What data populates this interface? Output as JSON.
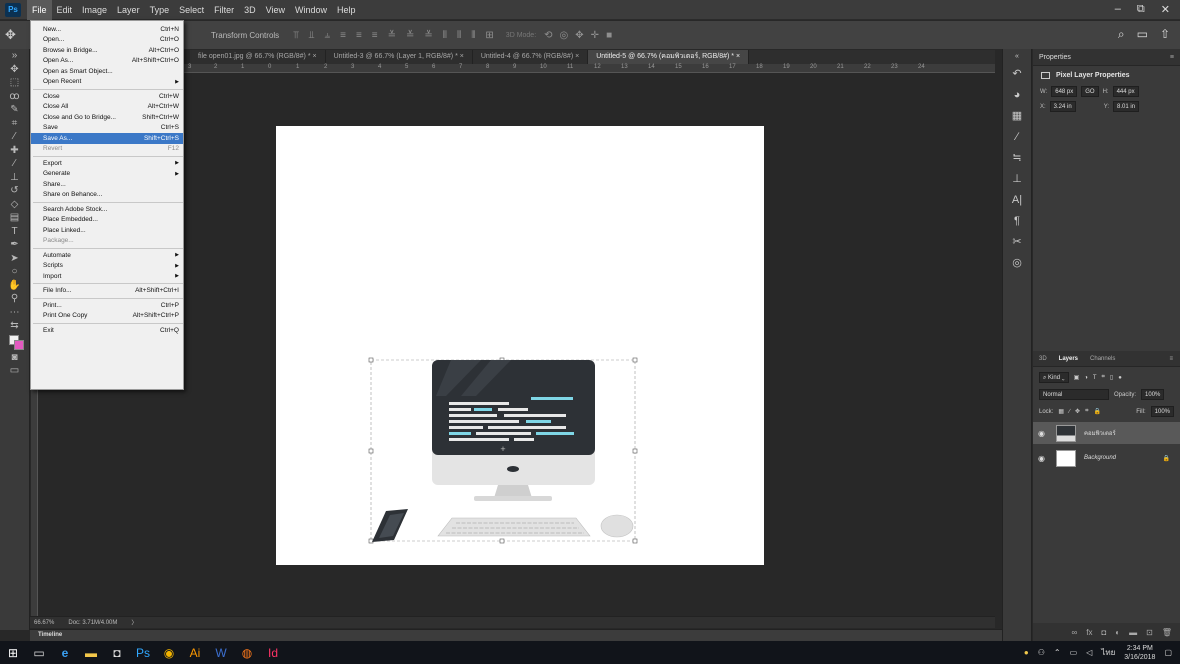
{
  "menubar": {
    "logo": "Ps",
    "items": [
      "File",
      "Edit",
      "Image",
      "Layer",
      "Type",
      "Select",
      "Filter",
      "3D",
      "View",
      "Window",
      "Help"
    ],
    "win_controls": [
      "–",
      "⧉",
      "✕"
    ]
  },
  "optionsbar": {
    "label": "Transform Controls",
    "mode_3d": "3D Mode:"
  },
  "tabs": [
    "file open01.jpg @ 66.7% (RGB/8#) * ×",
    "Untitled-3 @ 66.7% (Layer 1, RGB/8#) * ×",
    "Untitled-4 @ 66.7% (RGB/8#) ×",
    "Untitled-5 @ 66.7% (คอมพิวเตอร์, RGB/8#) * ×"
  ],
  "ruler": [
    "3",
    "2",
    "1",
    "0",
    "1",
    "2",
    "3",
    "4",
    "5",
    "6",
    "7",
    "8",
    "9",
    "10",
    "11",
    "12",
    "13",
    "14",
    "15",
    "16",
    "17",
    "18",
    "19",
    "20",
    "21",
    "22",
    "23",
    "24"
  ],
  "file_menu": [
    {
      "label": "New...",
      "shortcut": "Ctrl+N"
    },
    {
      "label": "Open...",
      "shortcut": "Ctrl+O"
    },
    {
      "label": "Browse in Bridge...",
      "shortcut": "Alt+Ctrl+O"
    },
    {
      "label": "Open As...",
      "shortcut": "Alt+Shift+Ctrl+O"
    },
    {
      "label": "Open as Smart Object...",
      "shortcut": ""
    },
    {
      "label": "Open Recent",
      "shortcut": "",
      "submenu": true
    },
    {
      "sep": true
    },
    {
      "label": "Close",
      "shortcut": "Ctrl+W"
    },
    {
      "label": "Close All",
      "shortcut": "Alt+Ctrl+W"
    },
    {
      "label": "Close and Go to Bridge...",
      "shortcut": "Shift+Ctrl+W"
    },
    {
      "label": "Save",
      "shortcut": "Ctrl+S"
    },
    {
      "label": "Save As...",
      "shortcut": "Shift+Ctrl+S",
      "highlighted": true
    },
    {
      "label": "Revert",
      "shortcut": "F12",
      "disabled": true
    },
    {
      "sep": true
    },
    {
      "label": "Export",
      "shortcut": "",
      "submenu": true
    },
    {
      "label": "Generate",
      "shortcut": "",
      "submenu": true
    },
    {
      "label": "Share...",
      "shortcut": ""
    },
    {
      "label": "Share on Behance...",
      "shortcut": ""
    },
    {
      "sep": true
    },
    {
      "label": "Search Adobe Stock...",
      "shortcut": ""
    },
    {
      "label": "Place Embedded...",
      "shortcut": ""
    },
    {
      "label": "Place Linked...",
      "shortcut": ""
    },
    {
      "label": "Package...",
      "shortcut": "",
      "disabled": true
    },
    {
      "sep": true
    },
    {
      "label": "Automate",
      "shortcut": "",
      "submenu": true
    },
    {
      "label": "Scripts",
      "shortcut": "",
      "submenu": true
    },
    {
      "label": "Import",
      "shortcut": "",
      "submenu": true
    },
    {
      "sep": true
    },
    {
      "label": "File Info...",
      "shortcut": "Alt+Shift+Ctrl+I"
    },
    {
      "sep": true
    },
    {
      "label": "Print...",
      "shortcut": "Ctrl+P"
    },
    {
      "label": "Print One Copy",
      "shortcut": "Alt+Shift+Ctrl+P"
    },
    {
      "sep": true
    },
    {
      "label": "Exit",
      "shortcut": "Ctrl+Q"
    }
  ],
  "status": {
    "zoom": "66.67%",
    "doc": "Doc: 3.71M/4.00M"
  },
  "timeline": "Timeline",
  "properties": {
    "title": "Properties",
    "subtitle": "Pixel Layer Properties",
    "w_label": "W:",
    "w": "648 px",
    "link": "GO",
    "h_label": "H:",
    "h": "444 px",
    "x_label": "X:",
    "x": "3.24 in",
    "y_label": "Y:",
    "y": "8.01 in"
  },
  "layers": {
    "tabs": [
      "3D",
      "Layers",
      "Channels"
    ],
    "kind": "Kind",
    "blend": "Normal",
    "opacity_label": "Opacity:",
    "opacity": "100%",
    "lock_label": "Lock:",
    "fill_label": "Fill:",
    "fill": "100%",
    "rows": [
      {
        "name": "คอมพิวเตอร์",
        "selected": true
      },
      {
        "name": "Background",
        "selected": false
      }
    ]
  },
  "taskbar": {
    "time": "2:34 PM",
    "date": "3/16/2018",
    "lang": "ไทย"
  }
}
